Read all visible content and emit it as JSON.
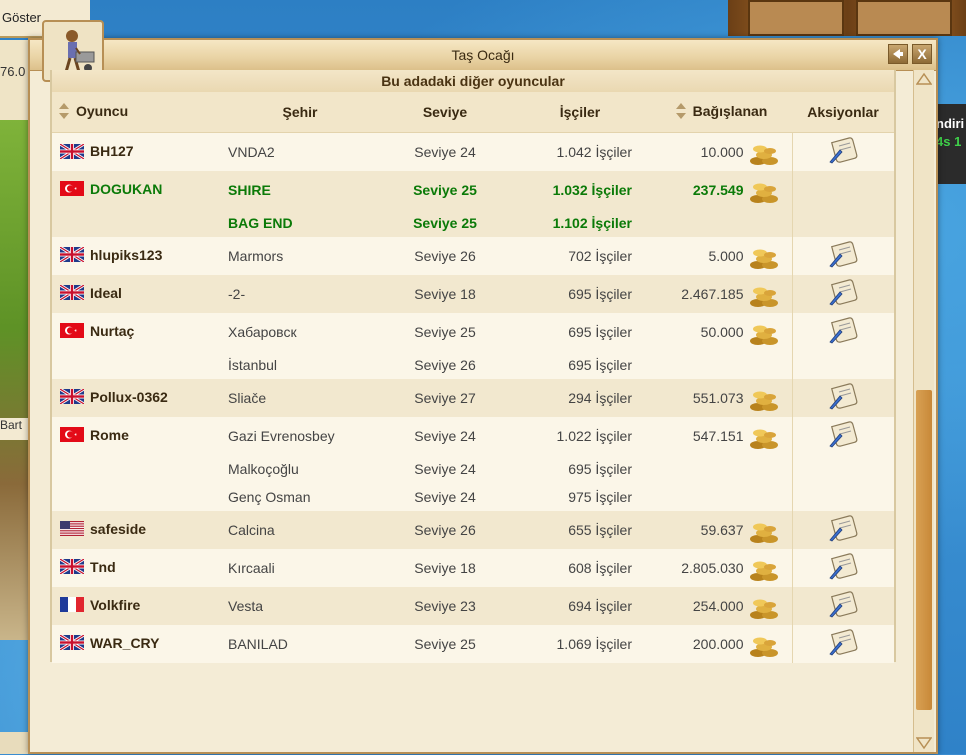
{
  "background": {
    "topleft_label": "Göster",
    "left_value": "76.0",
    "left_bottom_label": "Bart",
    "right_text_1": "ndiri",
    "right_text_2": "4s 1"
  },
  "window": {
    "title": "Taş Ocağı",
    "subtitle": "Bu adadaki diğer oyuncular",
    "back_icon": "back-arrow-icon",
    "close_label": "X"
  },
  "table": {
    "headers": {
      "player": "Oyuncu",
      "city": "Şehir",
      "level": "Seviye",
      "workers": "İşçiler",
      "donated": "Bağışlanan",
      "actions": "Aksiyonlar"
    },
    "players": [
      {
        "name": "BH127",
        "flag": "uk",
        "own": false,
        "donated": "10.000",
        "cities": [
          {
            "city": "VNDA2",
            "level": "Seviye 24",
            "workers": "1.042 İşçiler"
          }
        ]
      },
      {
        "name": "DOGUKAN",
        "flag": "tr",
        "own": true,
        "donated": "237.549",
        "cities": [
          {
            "city": "SHIRE",
            "level": "Seviye 25",
            "workers": "1.032 İşçiler"
          },
          {
            "city": "BAG END",
            "level": "Seviye 25",
            "workers": "1.102 İşçiler"
          }
        ]
      },
      {
        "name": "hlupiks123",
        "flag": "uk",
        "own": false,
        "donated": "5.000",
        "cities": [
          {
            "city": "Marmors",
            "level": "Seviye 26",
            "workers": "702 İşçiler"
          }
        ]
      },
      {
        "name": "Ideal",
        "flag": "uk",
        "own": false,
        "donated": "2.467.185",
        "cities": [
          {
            "city": "-2-",
            "level": "Seviye 18",
            "workers": "695 İşçiler"
          }
        ]
      },
      {
        "name": "Nurtaç",
        "flag": "tr",
        "own": false,
        "donated": "50.000",
        "cities": [
          {
            "city": "Хабаровск",
            "level": "Seviye 25",
            "workers": "695 İşçiler"
          },
          {
            "city": "İstanbul",
            "level": "Seviye 26",
            "workers": "695 İşçiler"
          }
        ]
      },
      {
        "name": "Pollux-0362",
        "flag": "uk",
        "own": false,
        "donated": "551.073",
        "cities": [
          {
            "city": "Sliače",
            "level": "Seviye 27",
            "workers": "294 İşçiler"
          }
        ]
      },
      {
        "name": "Rome",
        "flag": "tr",
        "own": false,
        "donated": "547.151",
        "cities": [
          {
            "city": "Gazi Evrenosbey",
            "level": "Seviye 24",
            "workers": "1.022 İşçiler"
          },
          {
            "city": "Malkoçoğlu",
            "level": "Seviye 24",
            "workers": "695 İşçiler"
          },
          {
            "city": "Genç Osman",
            "level": "Seviye 24",
            "workers": "975 İşçiler"
          }
        ]
      },
      {
        "name": "safeside",
        "flag": "us",
        "own": false,
        "donated": "59.637",
        "cities": [
          {
            "city": "Calcina",
            "level": "Seviye 26",
            "workers": "655 İşçiler"
          }
        ]
      },
      {
        "name": "Tnd",
        "flag": "uk",
        "own": false,
        "donated": "2.805.030",
        "cities": [
          {
            "city": "Kırcaali",
            "level": "Seviye 18",
            "workers": "608 İşçiler"
          }
        ]
      },
      {
        "name": "Volkfire",
        "flag": "fr",
        "own": false,
        "donated": "254.000",
        "cities": [
          {
            "city": "Vesta",
            "level": "Seviye 23",
            "workers": "694 İşçiler"
          }
        ]
      },
      {
        "name": "WAR_CRY",
        "flag": "uk",
        "own": false,
        "donated": "200.000",
        "cities": [
          {
            "city": "BANILAD",
            "level": "Seviye 25",
            "workers": "1.069 İşçiler"
          }
        ]
      }
    ]
  },
  "colors": {
    "own_player_text": "#0b7a08",
    "accent_border": "#b78f55",
    "scroll_thumb": "#c88838"
  },
  "icons": {
    "donated": "gold-coins-icon",
    "action": "message-scroll-icon",
    "sort": "sort-arrows-icon",
    "window": "worker-wheelbarrow-icon"
  }
}
